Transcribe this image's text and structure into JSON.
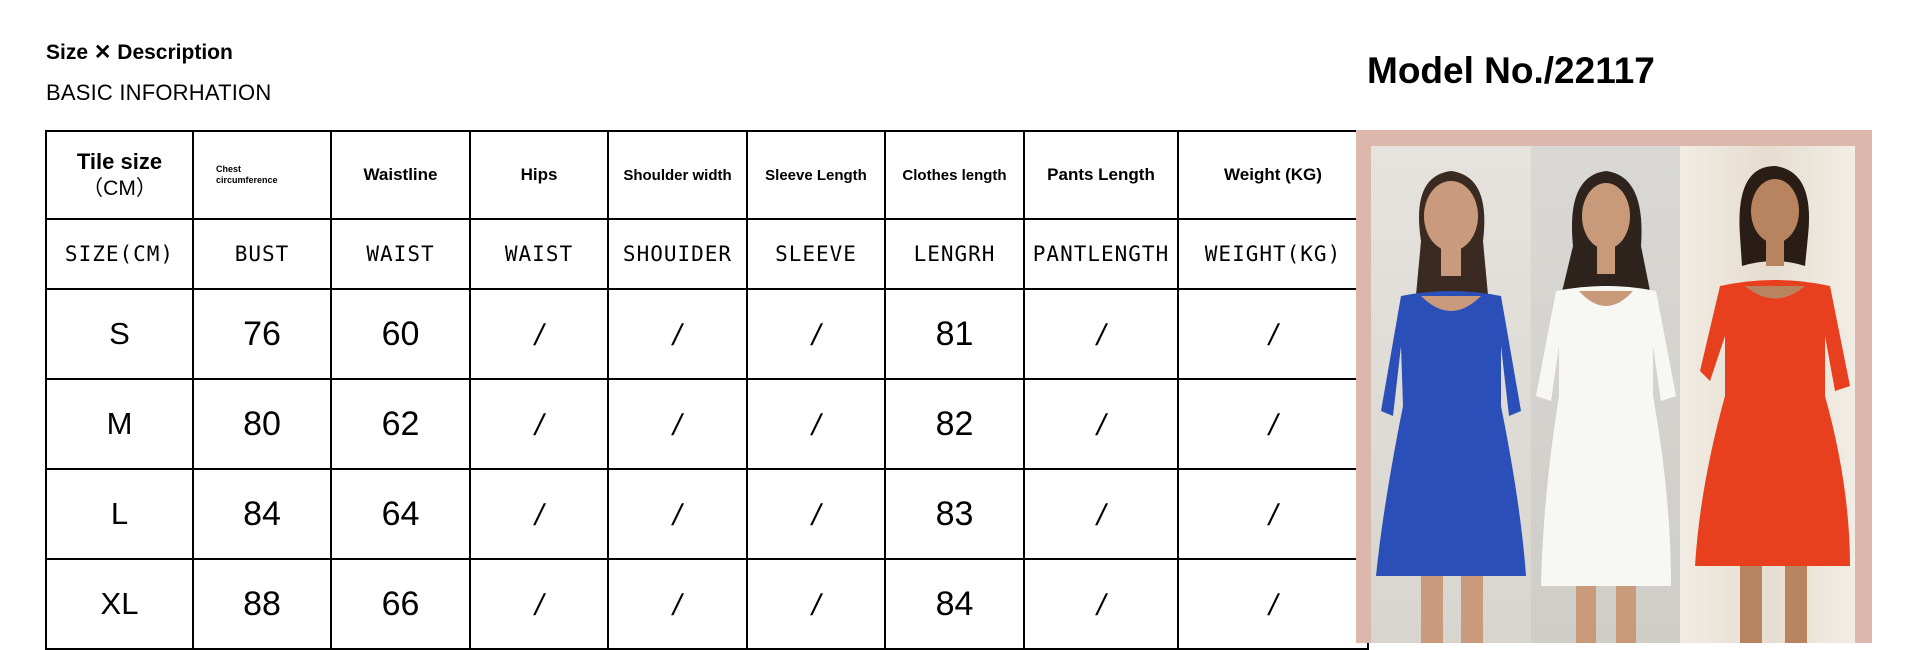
{
  "header": {
    "title": "Size ✕ Description",
    "subtitle": "BASIC INFORHATION",
    "model_no": "Model No./22117"
  },
  "table": {
    "header_row_1": [
      {
        "line1": "Tile size",
        "line2": "（CM）"
      },
      {
        "line1": "Chest",
        "line2": "circumference"
      },
      {
        "line1": "Waistline"
      },
      {
        "line1": "Hips"
      },
      {
        "line1": "Shoulder width"
      },
      {
        "line1": "Sleeve Length"
      },
      {
        "line1": "Clothes length"
      },
      {
        "line1": "Pants Length"
      },
      {
        "line1": "Weight (KG)"
      }
    ],
    "header_row_2": [
      "SIZE(CM)",
      "BUST",
      "WAIST",
      "WAIST",
      "SHOUIDER",
      "SLEEVE",
      "LENGRH",
      "PANTLENGTH",
      "WEIGHT(KG)"
    ],
    "rows": [
      [
        "S",
        "76",
        "60",
        "/",
        "/",
        "/",
        "81",
        "/",
        "/"
      ],
      [
        "M",
        "80",
        "62",
        "/",
        "/",
        "/",
        "82",
        "/",
        "/"
      ],
      [
        "L",
        "84",
        "64",
        "/",
        "/",
        "/",
        "83",
        "/",
        "/"
      ],
      [
        "XL",
        "88",
        "66",
        "/",
        "/",
        "/",
        "84",
        "/",
        "/"
      ]
    ]
  },
  "photos": {
    "dress_colors": [
      "#2a4fb8",
      "#f7f7f4",
      "#e8401f"
    ],
    "frame_color": "#dcb7ab"
  }
}
